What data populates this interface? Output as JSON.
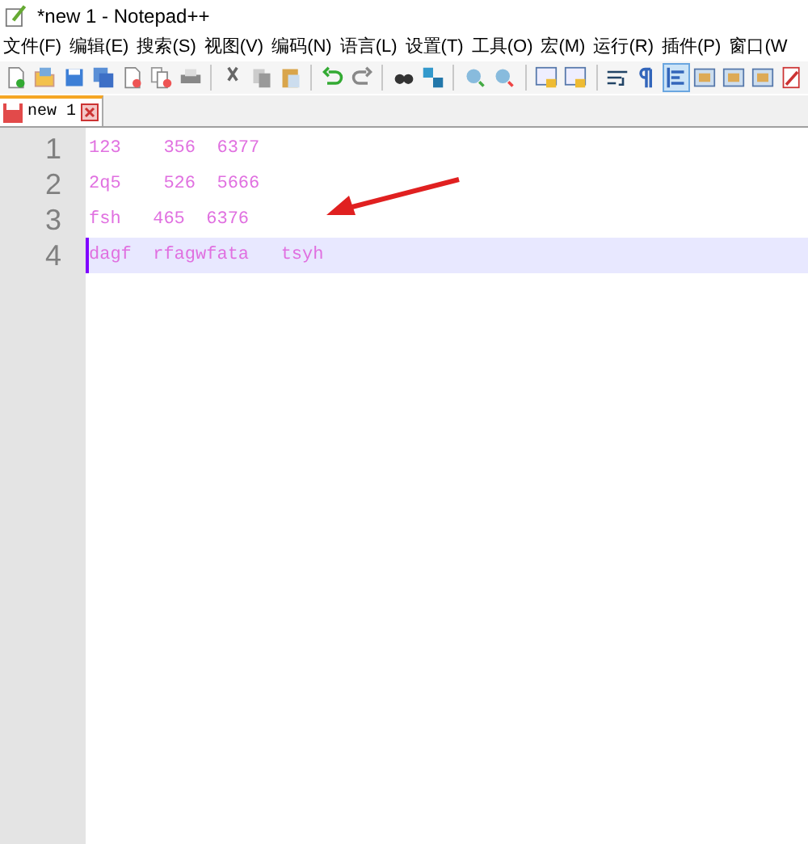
{
  "window": {
    "title": "*new 1 - Notepad++"
  },
  "menu": [
    "文件(F)",
    "编辑(E)",
    "搜索(S)",
    "视图(V)",
    "编码(N)",
    "语言(L)",
    "设置(T)",
    "工具(O)",
    "宏(M)",
    "运行(R)",
    "插件(P)",
    "窗口(W"
  ],
  "toolbar": [
    {
      "kind": "new",
      "selected": false
    },
    {
      "kind": "open",
      "selected": false
    },
    {
      "kind": "save",
      "selected": false
    },
    {
      "kind": "saveall",
      "selected": false
    },
    {
      "kind": "close",
      "selected": false
    },
    {
      "kind": "closeall",
      "selected": false
    },
    {
      "kind": "print",
      "selected": false
    },
    {
      "kind": "sep"
    },
    {
      "kind": "cut",
      "selected": false
    },
    {
      "kind": "copy",
      "selected": false
    },
    {
      "kind": "paste",
      "selected": false
    },
    {
      "kind": "sep"
    },
    {
      "kind": "undo",
      "selected": false
    },
    {
      "kind": "redo",
      "selected": false
    },
    {
      "kind": "sep"
    },
    {
      "kind": "find",
      "selected": false
    },
    {
      "kind": "replace",
      "selected": false
    },
    {
      "kind": "sep"
    },
    {
      "kind": "zoomin",
      "selected": false
    },
    {
      "kind": "zoomout",
      "selected": false
    },
    {
      "kind": "sep"
    },
    {
      "kind": "sync",
      "selected": false
    },
    {
      "kind": "sync",
      "selected": false
    },
    {
      "kind": "sep"
    },
    {
      "kind": "wrap",
      "selected": false
    },
    {
      "kind": "pilcrow",
      "selected": false
    },
    {
      "kind": "indent",
      "selected": true
    },
    {
      "kind": "panel",
      "selected": false
    },
    {
      "kind": "panel",
      "selected": false
    },
    {
      "kind": "panel",
      "selected": false
    },
    {
      "kind": "record",
      "selected": false
    }
  ],
  "tabs": [
    {
      "label": "new 1",
      "selected": true,
      "modified": true
    }
  ],
  "editor": {
    "lines": [
      {
        "number": "1",
        "text": "123    356  6377",
        "current": false
      },
      {
        "number": "2",
        "text": "2q5    526  5666",
        "current": false
      },
      {
        "number": "3",
        "text": "fsh   465  6376",
        "current": false
      },
      {
        "number": "4",
        "text": "dagf  rfagwfata   tsyh",
        "current": true
      }
    ]
  }
}
